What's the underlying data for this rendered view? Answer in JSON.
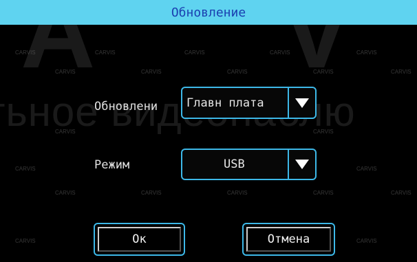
{
  "window": {
    "title": "Обновление"
  },
  "form": {
    "update_label": "Обновлени",
    "update_value": "Главн плата",
    "mode_label": "Режим",
    "mode_value": "USB"
  },
  "buttons": {
    "ok_label": "Ок",
    "cancel_label": "Отмена"
  },
  "watermark": {
    "large_text": "тьное видеонаблю",
    "brand": "CARVIS"
  },
  "colors": {
    "title_bar": "#5fd3f0",
    "title_text": "#1a3fb0",
    "accent_border": "#3db8e8",
    "background": "#000000"
  },
  "icons": [
    "dropdown-arrow-icon"
  ]
}
